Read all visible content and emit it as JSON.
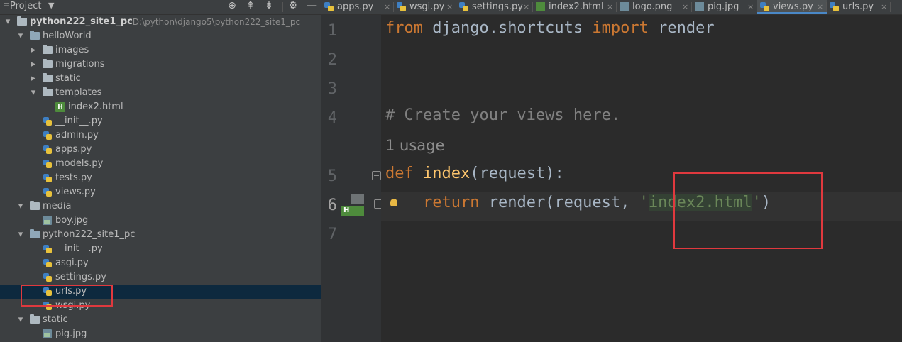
{
  "project_panel": {
    "title": "Project",
    "dropdown": "▼",
    "header_icons": [
      "crosshair-icon",
      "collapse-all-icon",
      "expand-all-icon",
      "gear-icon",
      "hide-icon"
    ]
  },
  "tree": [
    {
      "label": "python222_site1_pc",
      "path": "D:\\python\\django5\\python222_site1_pc",
      "icon": "folder",
      "depth": 0,
      "expanded": true,
      "bold": true
    },
    {
      "label": "helloWorld",
      "icon": "module-folder",
      "depth": 1,
      "expanded": true
    },
    {
      "label": "images",
      "icon": "folder",
      "depth": 2,
      "expanded": false
    },
    {
      "label": "migrations",
      "icon": "folder",
      "depth": 2,
      "expanded": false
    },
    {
      "label": "static",
      "icon": "folder",
      "depth": 2,
      "expanded": false
    },
    {
      "label": "templates",
      "icon": "folder",
      "depth": 2,
      "expanded": true
    },
    {
      "label": "index2.html",
      "icon": "html",
      "depth": 3
    },
    {
      "label": "__init__.py",
      "icon": "python",
      "depth": 2
    },
    {
      "label": "admin.py",
      "icon": "python",
      "depth": 2
    },
    {
      "label": "apps.py",
      "icon": "python",
      "depth": 2
    },
    {
      "label": "models.py",
      "icon": "python",
      "depth": 2
    },
    {
      "label": "tests.py",
      "icon": "python",
      "depth": 2
    },
    {
      "label": "views.py",
      "icon": "python",
      "depth": 2
    },
    {
      "label": "media",
      "icon": "folder",
      "depth": 1,
      "expanded": true
    },
    {
      "label": "boy.jpg",
      "icon": "jpg",
      "depth": 2
    },
    {
      "label": "python222_site1_pc",
      "icon": "module-folder",
      "depth": 1,
      "expanded": true
    },
    {
      "label": "__init__.py",
      "icon": "python",
      "depth": 2
    },
    {
      "label": "asgi.py",
      "icon": "python",
      "depth": 2
    },
    {
      "label": "settings.py",
      "icon": "python",
      "depth": 2
    },
    {
      "label": "urls.py",
      "icon": "python",
      "depth": 2,
      "selected": true
    },
    {
      "label": "wsgi.py",
      "icon": "python",
      "depth": 2
    },
    {
      "label": "static",
      "icon": "folder",
      "depth": 1,
      "expanded": true
    },
    {
      "label": "pig.jpg",
      "icon": "jpg",
      "depth": 2
    }
  ],
  "tabs": [
    {
      "label": "apps.py",
      "icon": "python"
    },
    {
      "label": "wsgi.py",
      "icon": "python"
    },
    {
      "label": "settings.py",
      "icon": "python"
    },
    {
      "label": "index2.html",
      "icon": "html"
    },
    {
      "label": "logo.png",
      "icon": "image"
    },
    {
      "label": "pig.jpg",
      "icon": "image"
    },
    {
      "label": "views.py",
      "icon": "python",
      "active": true
    },
    {
      "label": "urls.py",
      "icon": "python"
    }
  ],
  "editor": {
    "line_numbers": [
      "1",
      "2",
      "3",
      "4",
      "5",
      "6",
      "7"
    ],
    "current_line": "6",
    "line1": {
      "kw1": "from",
      "mid": " django.shortcuts ",
      "kw2": "import",
      "rest": " render"
    },
    "line4": {
      "comment": "# Create your views here."
    },
    "usage_hint": "1 usage",
    "line5": {
      "kw": "def",
      "fn": "index",
      "rest": "(request):"
    },
    "line6": {
      "indent": "    ",
      "kw": "return",
      "mid": " render(request, ",
      "q1": "'",
      "str": "index2.html",
      "q2": "'",
      "end": ")"
    },
    "gutter_badge": "H"
  }
}
